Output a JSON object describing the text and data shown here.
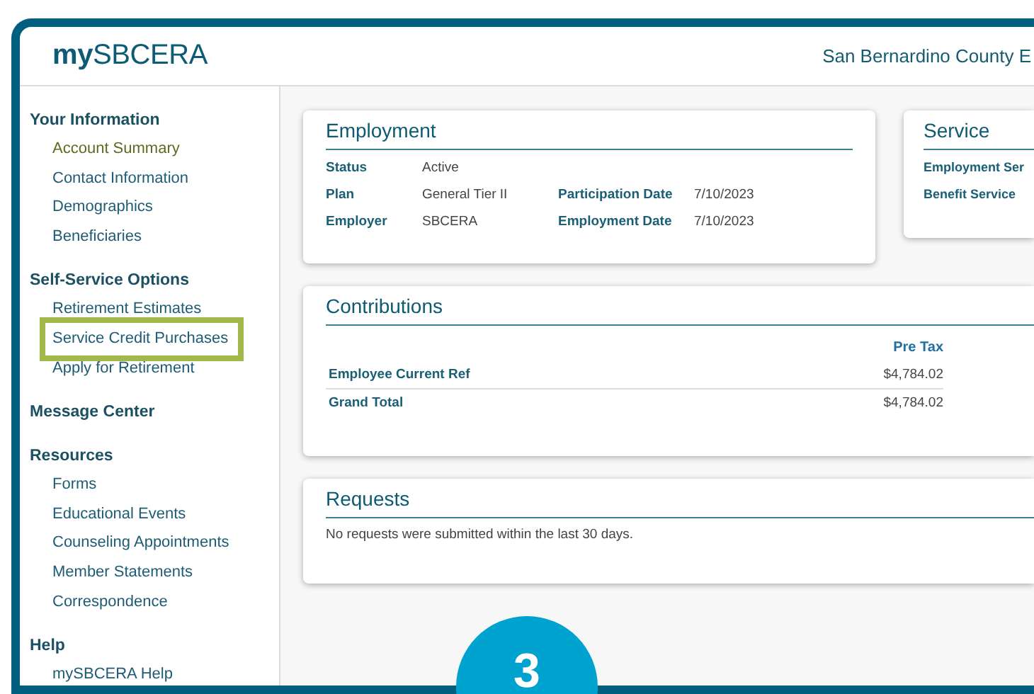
{
  "header": {
    "logo_bold": "my",
    "logo_rest": "SBCERA",
    "organization": "San Bernardino County E"
  },
  "sidebar": {
    "sections": [
      {
        "title": "Your Information",
        "items": [
          {
            "label": "Account Summary",
            "selected": true,
            "highlighted": false
          },
          {
            "label": "Contact Information",
            "selected": false,
            "highlighted": false
          },
          {
            "label": "Demographics",
            "selected": false,
            "highlighted": false
          },
          {
            "label": "Beneficiaries",
            "selected": false,
            "highlighted": false
          }
        ]
      },
      {
        "title": "Self-Service Options",
        "items": [
          {
            "label": "Retirement Estimates",
            "selected": false,
            "highlighted": false
          },
          {
            "label": "Service Credit Purchases",
            "selected": false,
            "highlighted": true
          },
          {
            "label": "Apply for Retirement",
            "selected": false,
            "highlighted": false
          }
        ]
      },
      {
        "title": "Message Center"
      },
      {
        "title": "Resources",
        "items": [
          {
            "label": "Forms",
            "selected": false,
            "highlighted": false
          },
          {
            "label": "Educational Events",
            "selected": false,
            "highlighted": false
          },
          {
            "label": "Counseling Appointments",
            "selected": false,
            "highlighted": false
          },
          {
            "label": "Member Statements",
            "selected": false,
            "highlighted": false
          },
          {
            "label": "Correspondence",
            "selected": false,
            "highlighted": false
          }
        ]
      },
      {
        "title": "Help",
        "items": [
          {
            "label": "mySBCERA Help",
            "selected": false,
            "highlighted": false
          }
        ]
      }
    ]
  },
  "employment": {
    "title": "Employment",
    "rows": [
      [
        {
          "label": "Status",
          "value": "Active"
        }
      ],
      [
        {
          "label": "Plan",
          "value": "General Tier II"
        },
        {
          "label": "Participation Date",
          "value": "7/10/2023"
        }
      ],
      [
        {
          "label": "Employer",
          "value": "SBCERA"
        },
        {
          "label": "Employment Date",
          "value": "7/10/2023"
        }
      ]
    ]
  },
  "service": {
    "title": "Service",
    "labels": [
      "Employment Ser",
      "Benefit Service"
    ]
  },
  "contributions": {
    "title": "Contributions",
    "columns": [
      "Pre Tax"
    ],
    "rows": [
      {
        "label": "Employee Current Ref",
        "values": [
          "$4,784.02"
        ]
      },
      {
        "label": "Grand Total",
        "values": [
          "$4,784.02"
        ]
      }
    ]
  },
  "requests": {
    "title": "Requests",
    "message": "No requests were submitted within the last 30 days."
  },
  "step_badge": "3"
}
